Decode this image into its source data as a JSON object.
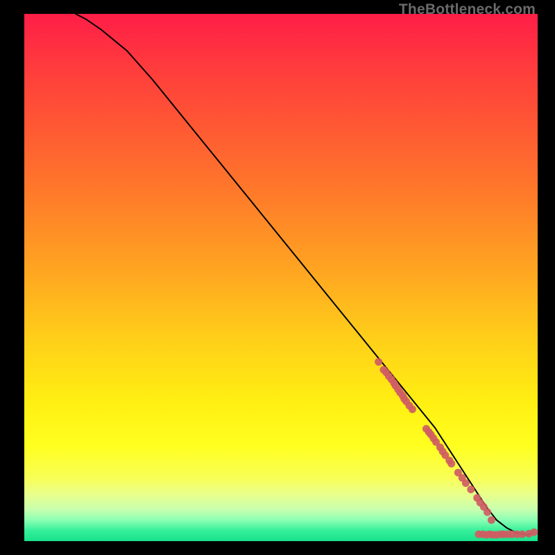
{
  "watermark": "TheBottleneck.com",
  "chart_data": {
    "type": "line",
    "title": "",
    "xlabel": "",
    "ylabel": "",
    "xlim": [
      0,
      100
    ],
    "ylim": [
      0,
      100
    ],
    "curve": {
      "name": "bottleneck-curve",
      "x": [
        10,
        12,
        15,
        20,
        25,
        30,
        35,
        40,
        45,
        50,
        55,
        60,
        65,
        70,
        75,
        80,
        83,
        86,
        88,
        90,
        92,
        94,
        96,
        98,
        99
      ],
      "y": [
        100,
        99,
        97,
        93,
        87.5,
        81.5,
        75.5,
        69.5,
        63.5,
        57.5,
        51.5,
        45.5,
        39.5,
        33.5,
        27.5,
        21.5,
        17,
        12.5,
        9.5,
        6.5,
        4,
        2.5,
        1.5,
        1.2,
        1.5
      ]
    },
    "scatter": {
      "name": "data-points",
      "color": "#cf5c63",
      "points": [
        {
          "x": 69,
          "y": 34
        },
        {
          "x": 70,
          "y": 32.5
        },
        {
          "x": 70.5,
          "y": 32
        },
        {
          "x": 71,
          "y": 31.3
        },
        {
          "x": 71.5,
          "y": 30.7
        },
        {
          "x": 72,
          "y": 30
        },
        {
          "x": 72.3,
          "y": 29.5
        },
        {
          "x": 72.8,
          "y": 28.8
        },
        {
          "x": 73.2,
          "y": 28.2
        },
        {
          "x": 73.7,
          "y": 27.6
        },
        {
          "x": 74,
          "y": 27
        },
        {
          "x": 74.4,
          "y": 26.5
        },
        {
          "x": 75,
          "y": 25.7
        },
        {
          "x": 75.6,
          "y": 25
        },
        {
          "x": 78.3,
          "y": 21.3
        },
        {
          "x": 78.8,
          "y": 20.7
        },
        {
          "x": 79.2,
          "y": 20.2
        },
        {
          "x": 79.7,
          "y": 19.5
        },
        {
          "x": 80.2,
          "y": 18.8
        },
        {
          "x": 81,
          "y": 17.8
        },
        {
          "x": 81.5,
          "y": 17
        },
        {
          "x": 82,
          "y": 16.3
        },
        {
          "x": 82.8,
          "y": 15.3
        },
        {
          "x": 83.2,
          "y": 14.7
        },
        {
          "x": 84.5,
          "y": 13
        },
        {
          "x": 85.3,
          "y": 12
        },
        {
          "x": 86,
          "y": 11
        },
        {
          "x": 87,
          "y": 9.8
        },
        {
          "x": 88.2,
          "y": 8.2
        },
        {
          "x": 88.8,
          "y": 7.3
        },
        {
          "x": 89.5,
          "y": 6.5
        },
        {
          "x": 90.2,
          "y": 5.5
        },
        {
          "x": 91,
          "y": 4
        },
        {
          "x": 88.5,
          "y": 1.3
        },
        {
          "x": 89.3,
          "y": 1.3
        },
        {
          "x": 90,
          "y": 1.2
        },
        {
          "x": 90.7,
          "y": 1.3
        },
        {
          "x": 91.3,
          "y": 1.2
        },
        {
          "x": 92,
          "y": 1.2
        },
        {
          "x": 92.8,
          "y": 1.3
        },
        {
          "x": 93.4,
          "y": 1.3
        },
        {
          "x": 94.2,
          "y": 1.3
        },
        {
          "x": 95,
          "y": 1.3
        },
        {
          "x": 96,
          "y": 1.3
        },
        {
          "x": 97,
          "y": 1.3
        },
        {
          "x": 98.3,
          "y": 1.4
        },
        {
          "x": 99.3,
          "y": 1.7
        }
      ]
    }
  }
}
